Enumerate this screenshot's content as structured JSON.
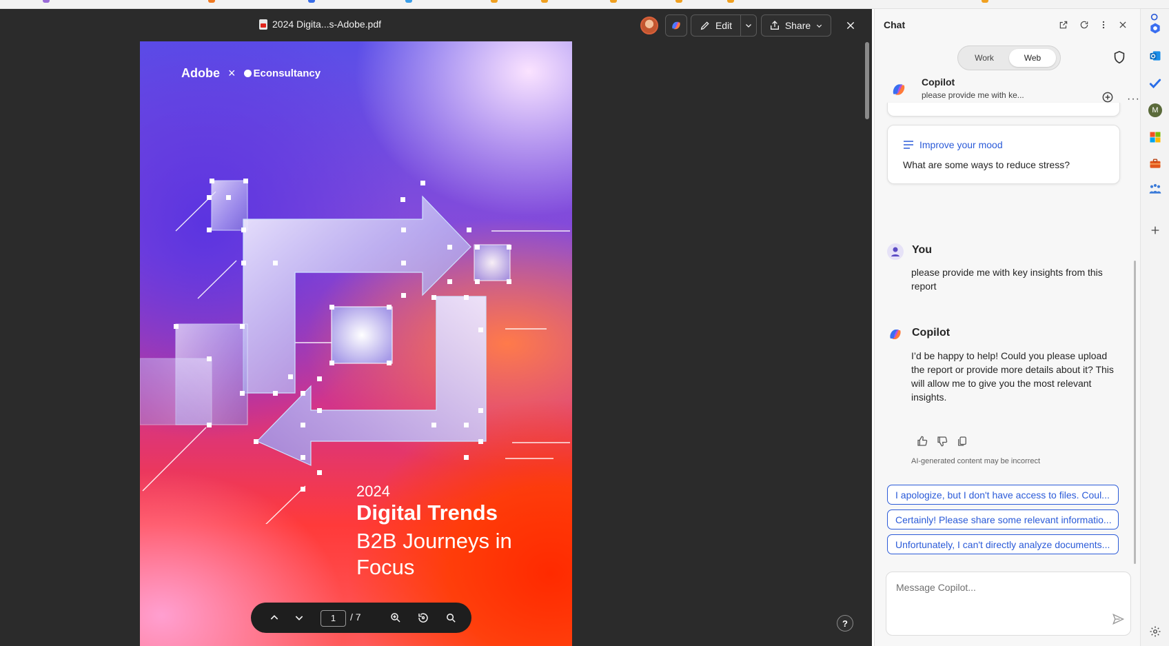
{
  "viewer": {
    "doc_title": "2024 Digita...s-Adobe.pdf",
    "edit_label": "Edit",
    "share_label": "Share",
    "page_current": "1",
    "page_total": "/ 7",
    "help_label": "?"
  },
  "pdf_page": {
    "brand_left": "Adobe",
    "brand_x": "×",
    "brand_right": "Econsultancy",
    "year": "2024",
    "headline": "Digital Trends",
    "subline": "B2B Journeys in Focus"
  },
  "chat": {
    "title": "Chat",
    "toggle": {
      "work": "Work",
      "web": "Web",
      "selected": "Web"
    },
    "conversation": {
      "name": "Copilot",
      "preview": "please provide me with ke..."
    },
    "prompt_card": {
      "category": "Improve your mood",
      "question": "What are some ways to reduce stress?"
    },
    "user_message": {
      "author": "You",
      "text": "please provide me with key insights from this report"
    },
    "bot_message": {
      "author": "Copilot",
      "text": "I’d be happy to help! Could you please upload the report or provide more details about it? This will allow me to give you the most relevant insights."
    },
    "disclaimer": "AI-generated content may be incorrect",
    "suggestions": [
      "I apologize, but I don't have access to files. Coul...",
      "Certainly! Please share some relevant informatio...",
      "Unfortunately, I can't directly analyze documents..."
    ],
    "input_placeholder": "Message Copilot..."
  },
  "rail": {
    "icons": [
      "copilot-icon",
      "outlook-icon",
      "todo-icon",
      "profile-icon",
      "office-icon",
      "toolbox-icon",
      "people-icon",
      "add-icon",
      "settings-icon"
    ],
    "profile_initial": "M"
  },
  "colors": {
    "viewer_bg": "#2b2b2b",
    "chat_bg": "#f7f7f7",
    "accent_blue": "#2a5ad8"
  }
}
